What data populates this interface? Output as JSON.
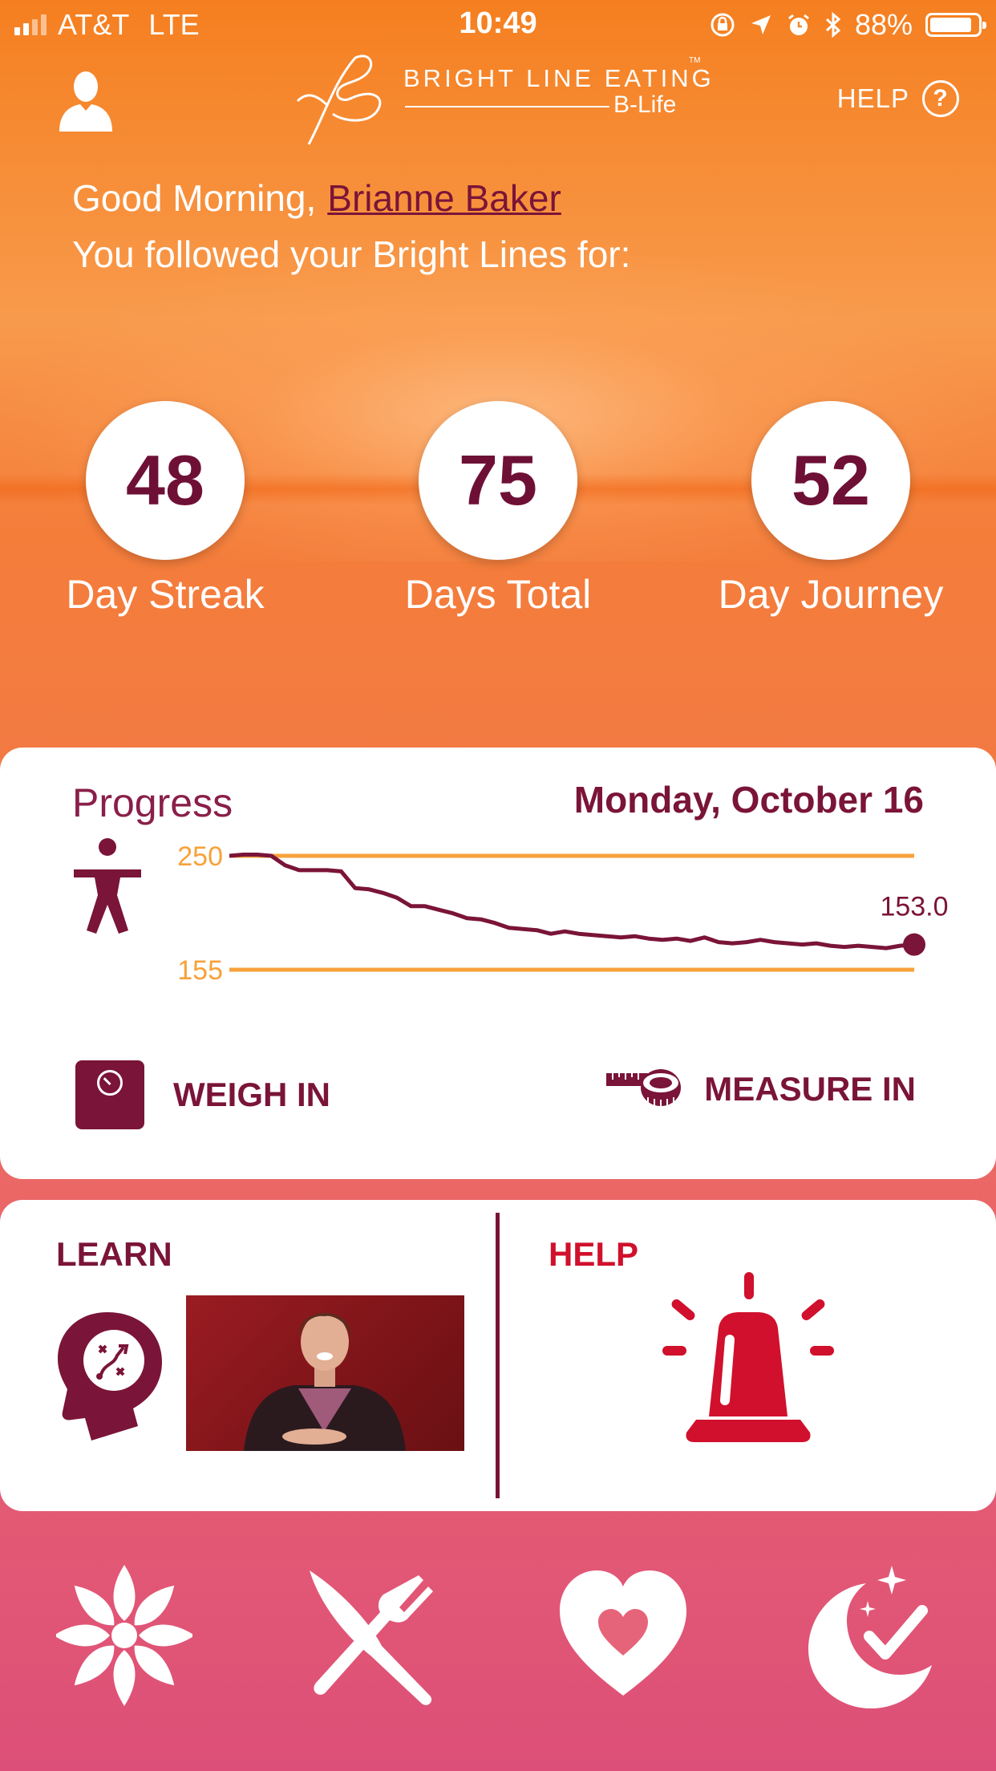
{
  "status_bar": {
    "carrier": "AT&T",
    "network": "LTE",
    "time": "10:49",
    "battery": "88%",
    "battery_level": 0.88
  },
  "header": {
    "logo_text": "BRIGHT LINE EATING",
    "logo_tm": "TM",
    "logo_sub": "B-Life",
    "help_label": "HELP",
    "help_glyph": "?"
  },
  "greeting": {
    "prefix": "Good Morning,",
    "user_name": "Brianne Baker",
    "line2": "You followed your Bright Lines for:"
  },
  "stats": [
    {
      "value": "48",
      "label": "Day Streak"
    },
    {
      "value": "75",
      "label": "Days Total"
    },
    {
      "value": "52",
      "label": "Day Journey"
    }
  ],
  "progress": {
    "title": "Progress",
    "date": "Monday, October 16",
    "weigh_in_label": "WEIGH IN",
    "measure_in_label": "MEASURE IN"
  },
  "chart_data": {
    "type": "line",
    "title": "",
    "xlabel": "",
    "ylabel": "",
    "reference_lines": [
      250,
      155
    ],
    "reference_labels": [
      "250",
      "155"
    ],
    "ylim": [
      145,
      260
    ],
    "last_value_label": "153.0",
    "series": [
      {
        "values": [
          250,
          251,
          251,
          250,
          242,
          238,
          238,
          238,
          237,
          223,
          222,
          219,
          215,
          208,
          208,
          205,
          202,
          198,
          197,
          194,
          190,
          189,
          188,
          185,
          187,
          185,
          184,
          183,
          182,
          183,
          181,
          180,
          181,
          179,
          182,
          178,
          177,
          178,
          180,
          178,
          177,
          176,
          177,
          175,
          174,
          175,
          174,
          173,
          175,
          176
        ]
      }
    ],
    "colors": {
      "line": "#7a1438",
      "reference": "#f7a13a"
    }
  },
  "learn": {
    "title": "LEARN"
  },
  "help": {
    "title": "HELP"
  },
  "bottom_nav": [
    {
      "icon": "lotus-icon"
    },
    {
      "icon": "knife-fork-icon"
    },
    {
      "icon": "heart-icon"
    },
    {
      "icon": "moon-check-icon"
    }
  ],
  "colors": {
    "brand": "#7a1438",
    "alert": "#d0102c",
    "accent": "#f7a13a"
  }
}
